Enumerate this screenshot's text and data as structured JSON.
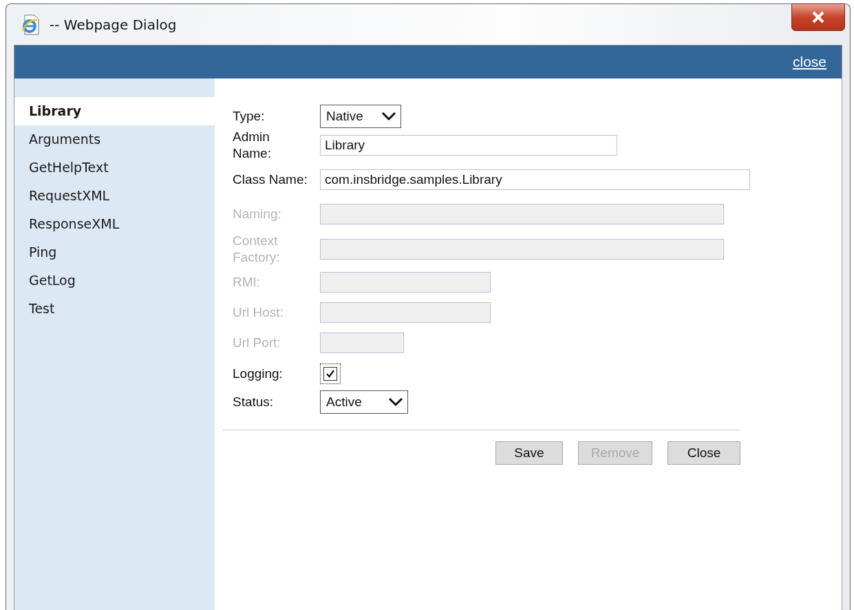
{
  "window": {
    "title": "-- Webpage Dialog"
  },
  "header": {
    "link": "close"
  },
  "sidebar": {
    "items": [
      {
        "label": "Library",
        "selected": true
      },
      {
        "label": "Arguments",
        "selected": false
      },
      {
        "label": "GetHelpText",
        "selected": false
      },
      {
        "label": "RequestXML",
        "selected": false
      },
      {
        "label": "ResponseXML",
        "selected": false
      },
      {
        "label": "Ping",
        "selected": false
      },
      {
        "label": "GetLog",
        "selected": false
      },
      {
        "label": "Test",
        "selected": false
      }
    ]
  },
  "form": {
    "fields": [
      {
        "kind": "select",
        "label": "Type:",
        "value": "Native",
        "disabled": false
      },
      {
        "kind": "text",
        "label": "Admin Name:",
        "value": "Library",
        "disabled": false
      },
      {
        "kind": "text",
        "label": "Class Name:",
        "value": "com.insbridge.samples.Library",
        "disabled": false
      },
      {
        "kind": "text",
        "label": "Naming:",
        "disabled": true
      },
      {
        "kind": "text",
        "label": "Context Factory:",
        "disabled": true
      },
      {
        "kind": "text",
        "label": "RMI:",
        "disabled": true
      },
      {
        "kind": "text",
        "label": "Url Host:",
        "disabled": true
      },
      {
        "kind": "text",
        "label": "Url Port:",
        "disabled": true
      },
      {
        "kind": "checkbox",
        "label": "Logging:",
        "checked": true,
        "disabled": false
      },
      {
        "kind": "select",
        "label": "Status:",
        "value": "Active",
        "disabled": false
      }
    ]
  },
  "buttons": [
    {
      "label": "Save",
      "disabled": false
    },
    {
      "label": "Remove",
      "disabled": true
    },
    {
      "label": "Close",
      "disabled": false
    }
  ]
}
